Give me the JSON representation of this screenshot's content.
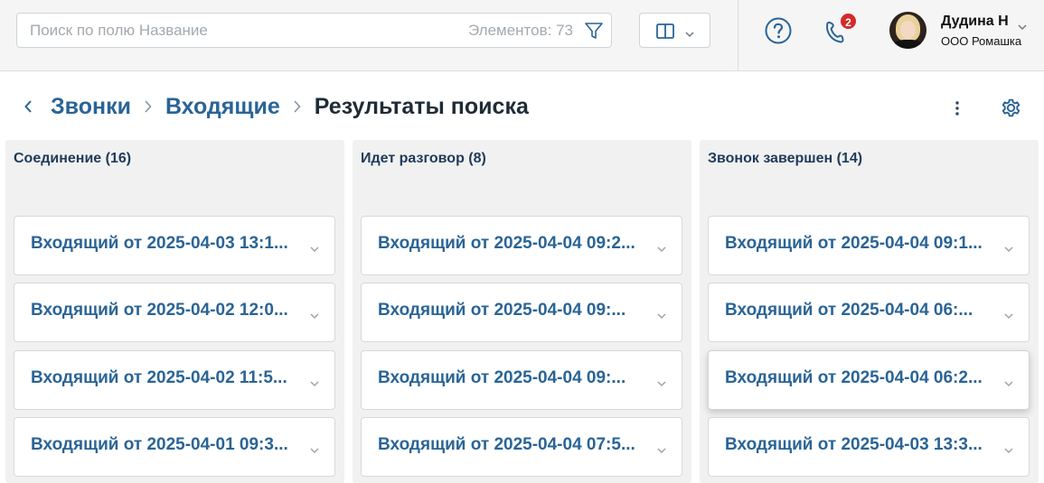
{
  "search": {
    "placeholder": "Поиск по полю Название",
    "count_label": "Элементов: 73"
  },
  "header": {
    "notification_count": "2",
    "user_name": "Дудина Н",
    "user_company": "ООО Ромашка"
  },
  "breadcrumbs": [
    {
      "label": "Звонки"
    },
    {
      "label": "Входящие"
    },
    {
      "label": "Результаты поиска"
    }
  ],
  "columns": [
    {
      "title": "Соединение (16)",
      "cards": [
        "Входящий от 2025-04-03 13:1...",
        "Входящий от 2025-04-02 12:0...",
        "Входящий от 2025-04-02 11:5...",
        "Входящий от 2025-04-01 09:3..."
      ]
    },
    {
      "title": "Идет разговор (8)",
      "cards": [
        "Входящий от 2025-04-04 09:2...",
        "Входящий от 2025-04-04 09:...",
        "Входящий от 2025-04-04 09:...",
        "Входящий от 2025-04-04 07:5..."
      ]
    },
    {
      "title": "Звонок завершен (14)",
      "cards": [
        "Входящий от 2025-04-04 09:1...",
        "Входящий от 2025-04-04 06:...",
        "Входящий от 2025-04-04 06:2...",
        "Входящий от 2025-04-03 13:3..."
      ]
    }
  ],
  "icons": {
    "filter": "filter-icon",
    "view": "columns-view-icon",
    "help": "help-circle-icon",
    "phone": "phone-icon",
    "back": "chevron-left-icon",
    "separator": "chevron-right-icon",
    "more": "kebab-menu-icon",
    "settings": "gear-icon",
    "expand": "chevron-down-icon"
  },
  "colors": {
    "accent": "#2a6496",
    "badge": "#d42a2a",
    "topbar_bg": "#f5f5f5",
    "column_bg": "#f1f1f1"
  }
}
